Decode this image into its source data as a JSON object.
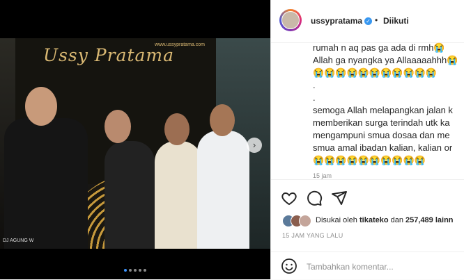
{
  "photo": {
    "brand": "Ussy Pratama",
    "url": "www.ussypratama.com",
    "credit": "DJ AGUNG W",
    "next_arrow": "›",
    "carousel_count": 5,
    "carousel_active": 0
  },
  "header": {
    "username": "ussypratama",
    "verified": "✓",
    "separator": "•",
    "follow_status": "Diikuti"
  },
  "comments": [
    "rumah n aq pas ga ada di rmh😭",
    "Allah ga nyangka ya Allaaaaahhh😭",
    "😭😭😭😭😭😭😭😭😭😭😭",
    ".",
    ".",
    "semoga Allah melapangkan jalan k",
    "memberikan surga terindah utk ka",
    "mengampuni smua dosaa dan me",
    "smua amal ibadan kalian, kalian or",
    "😭😭😭😭😭😭😭😭😭😭"
  ],
  "time": "15 jam",
  "likes": {
    "prefix": "Disukai oleh ",
    "user": "tikateko",
    "mid": " dan ",
    "count": "257,489",
    "suffix": " lainn"
  },
  "posted_ago": "15 JAM YANG LALU",
  "add_comment_placeholder": "Tambahkan komentar...",
  "colors": {
    "accent": "#3897f0",
    "brand_gold": "#d9b873"
  }
}
